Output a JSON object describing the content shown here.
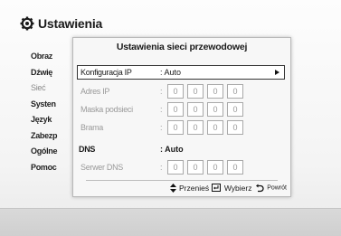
{
  "header": {
    "icon": "gear-icon",
    "title": "Ustawienia"
  },
  "side_menu": {
    "items": [
      {
        "label": "Obraz",
        "dim": false
      },
      {
        "label": "Dźwię",
        "dim": false
      },
      {
        "label": "Sieć",
        "dim": true
      },
      {
        "label": "Systen",
        "dim": false
      },
      {
        "label": "Język",
        "dim": false
      },
      {
        "label": "Zabezp",
        "dim": false
      },
      {
        "label": "Ogólne",
        "dim": false
      },
      {
        "label": "Pomoc",
        "dim": false
      }
    ]
  },
  "dialog": {
    "title": "Ustawienia sieci przewodowej",
    "config_label": "Konfiguracja IP",
    "config_value": ": Auto",
    "ip_label": "Adres IP",
    "mask_label": "Maska podsieci",
    "gateway_label": "Brama",
    "colon": ":",
    "ip_values": [
      "0",
      "0",
      "0",
      "0"
    ],
    "mask_values": [
      "0",
      "0",
      "0",
      "0"
    ],
    "gateway_values": [
      "0",
      "0",
      "0",
      "0"
    ],
    "dns_label": "DNS",
    "dns_value": ": Auto",
    "dns_server_label": "Serwer DNS",
    "dns_server_values": [
      "0",
      "0",
      "0",
      "0"
    ]
  },
  "footer": {
    "move_icon": "up-down-arrows-icon",
    "move_label": "Przenieś",
    "select_icon": "enter-icon",
    "select_label": "Wybierz",
    "return_icon": "return-icon",
    "return_label": "Powrót"
  }
}
